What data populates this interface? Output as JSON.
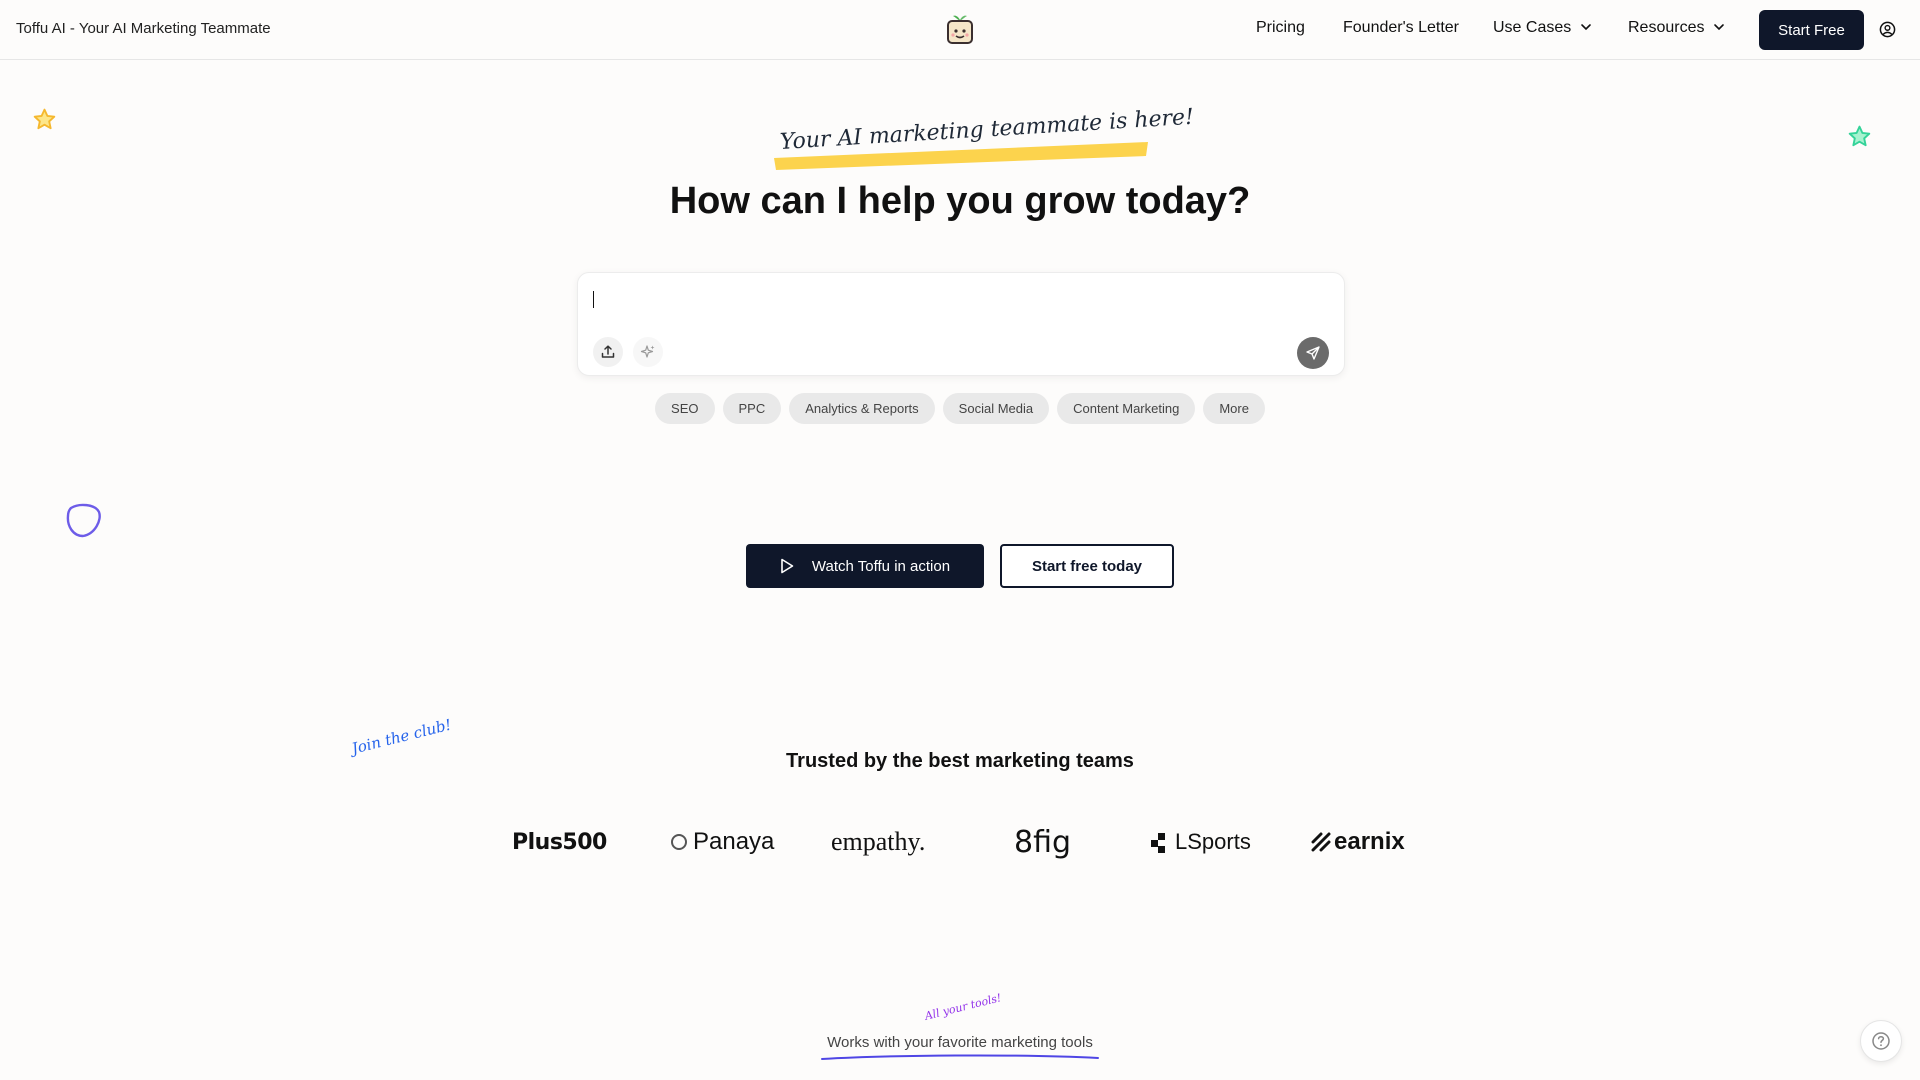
{
  "header": {
    "site_title": "Toffu AI - Your AI Marketing Teammate",
    "logo_icon": "toffu-logo-icon",
    "nav": {
      "pricing": "Pricing",
      "founders_letter": "Founder's Letter",
      "use_cases": "Use Cases",
      "resources": "Resources"
    },
    "start_free": "Start Free",
    "account_icon": "user-circle-icon"
  },
  "hero": {
    "tagline": "Your AI marketing teammate is here!",
    "headline": "How can I help you grow today?",
    "chat": {
      "input_value": "",
      "upload_icon": "upload-icon",
      "sparkle_icon": "sparkle-icon",
      "send_icon": "send-icon"
    },
    "chips": [
      "SEO",
      "PPC",
      "Analytics & Reports",
      "Social Media",
      "Content Marketing",
      "More"
    ],
    "cta_watch": "Watch Toffu in action",
    "cta_start": "Start free today"
  },
  "trusted": {
    "annotation": "Join the club!",
    "title": "Trusted by the best marketing teams",
    "logos": {
      "plus500": "Plus500",
      "panaya": "Panaya",
      "empathy": "empathy.",
      "eightfig": "8fig",
      "lsports": "LSports",
      "earnix": "earnix"
    }
  },
  "works": {
    "annotation": "All your tools!",
    "text": "Works with your favorite marketing tools"
  },
  "colors": {
    "primary_dark": "#0f172a",
    "highlight_yellow": "#fcd34d",
    "star_gold": "#f5b82e",
    "star_green": "#34d399",
    "blob_purple": "#6d5ce8",
    "annotation_blue": "#2563eb",
    "annotation_purple": "#9333ea"
  },
  "help_icon": "help-circle-icon"
}
